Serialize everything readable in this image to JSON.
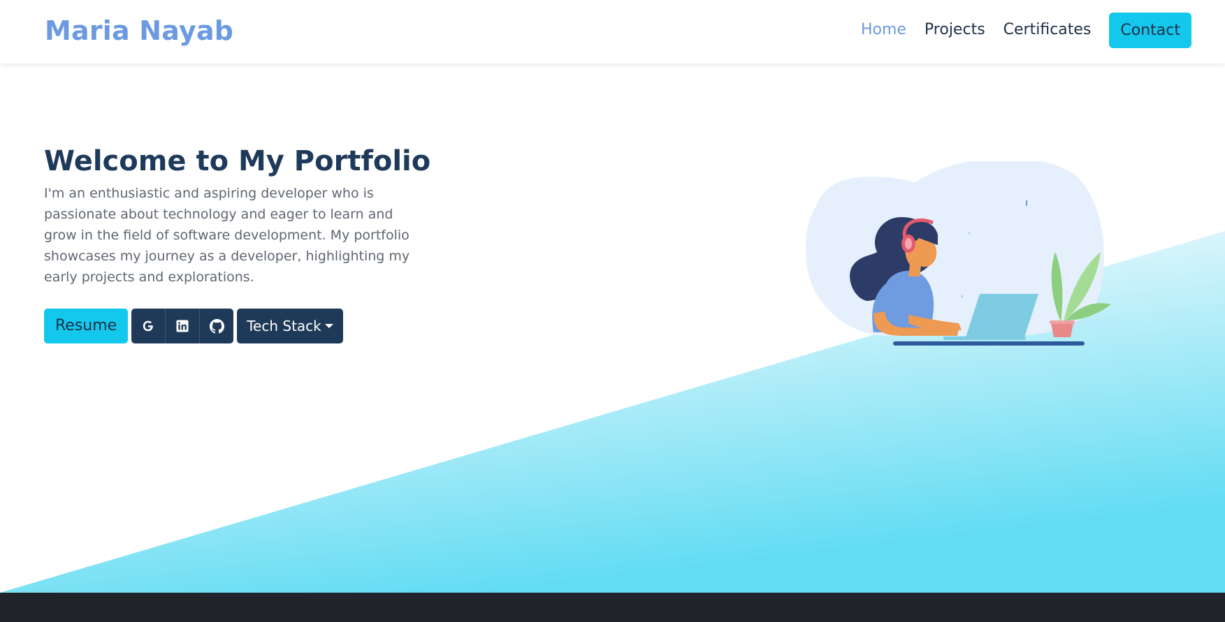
{
  "navbar": {
    "brand": "Maria Nayab",
    "links": [
      {
        "label": "Home",
        "active": true
      },
      {
        "label": "Projects",
        "active": false
      },
      {
        "label": "Certificates",
        "active": false
      }
    ],
    "contact_label": "Contact"
  },
  "hero": {
    "title": "Welcome to My Portfolio",
    "description": "I'm an enthusiastic and aspiring developer who is passionate about technology and eager to learn and grow in the field of software development. My portfolio showcases my journey as a developer, highlighting my early projects and explorations.",
    "resume_label": "Resume",
    "social_icons": [
      "google-icon",
      "linkedin-icon",
      "github-icon"
    ],
    "tech_stack_label": "Tech Stack"
  },
  "colors": {
    "brand": "#6b9ae0",
    "accent": "#13c8ec",
    "dark": "#1f3a58",
    "footer": "#202329"
  }
}
